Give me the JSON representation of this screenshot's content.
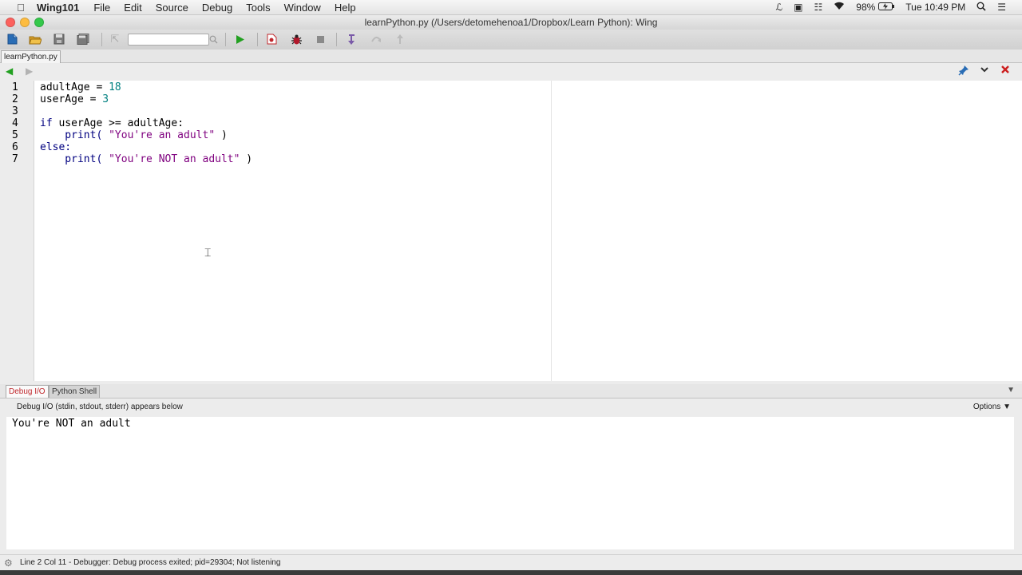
{
  "menubar": {
    "app_name": "Wing101",
    "items": [
      "File",
      "Edit",
      "Source",
      "Debug",
      "Tools",
      "Window",
      "Help"
    ],
    "battery": "98%",
    "clock": "Tue 10:49 PM"
  },
  "window": {
    "title": "learnPython.py (/Users/detomehenoa1/Dropbox/Learn Python): Wing"
  },
  "toolbar": {
    "search_value": "",
    "icons": [
      "new-file-icon",
      "open-folder-icon",
      "save-icon",
      "save-all-icon",
      "goto-icon",
      "search-icon",
      "run-icon",
      "debug-file-icon",
      "bug-icon",
      "stop-icon",
      "step-into-icon",
      "step-over-icon",
      "step-out-icon"
    ]
  },
  "editor": {
    "tab_label": "learnPython.py",
    "lines": [
      {
        "num": "1",
        "parts": [
          {
            "t": "adultAge = ",
            "c": "plain"
          },
          {
            "t": "18",
            "c": "num"
          }
        ]
      },
      {
        "num": "2",
        "parts": [
          {
            "t": "userAge = ",
            "c": "plain"
          },
          {
            "t": "3",
            "c": "num"
          }
        ]
      },
      {
        "num": "3",
        "parts": []
      },
      {
        "num": "4",
        "parts": [
          {
            "t": "if",
            "c": "kw"
          },
          {
            "t": " userAge >= adultAge:",
            "c": "plain"
          }
        ]
      },
      {
        "num": "5",
        "parts": [
          {
            "t": "    print( ",
            "c": "kw"
          },
          {
            "t": "\"You're an adult\"",
            "c": "str"
          },
          {
            "t": " )",
            "c": "plain"
          }
        ]
      },
      {
        "num": "6",
        "parts": [
          {
            "t": "else:",
            "c": "kw"
          }
        ]
      },
      {
        "num": "7",
        "parts": [
          {
            "t": "    print( ",
            "c": "kw"
          },
          {
            "t": "\"You're NOT an adult\"",
            "c": "str"
          },
          {
            "t": " )",
            "c": "plain"
          }
        ]
      }
    ]
  },
  "bottom_panel": {
    "tabs": [
      "Debug I/O",
      "Python Shell"
    ],
    "active_tab": "Debug I/O",
    "caption": "Debug I/O (stdin, stdout, stderr) appears below",
    "options_label": "Options",
    "output": "You're NOT an adult"
  },
  "status": {
    "text": "Line 2 Col 11 - Debugger: Debug process exited; pid=29304; Not listening"
  },
  "colors": {
    "keyword": "#000080",
    "number": "#008080",
    "string": "#7f007f",
    "active_tab_text": "#c0282d",
    "run_green": "#22a020",
    "close_red": "#cc1f1f"
  }
}
